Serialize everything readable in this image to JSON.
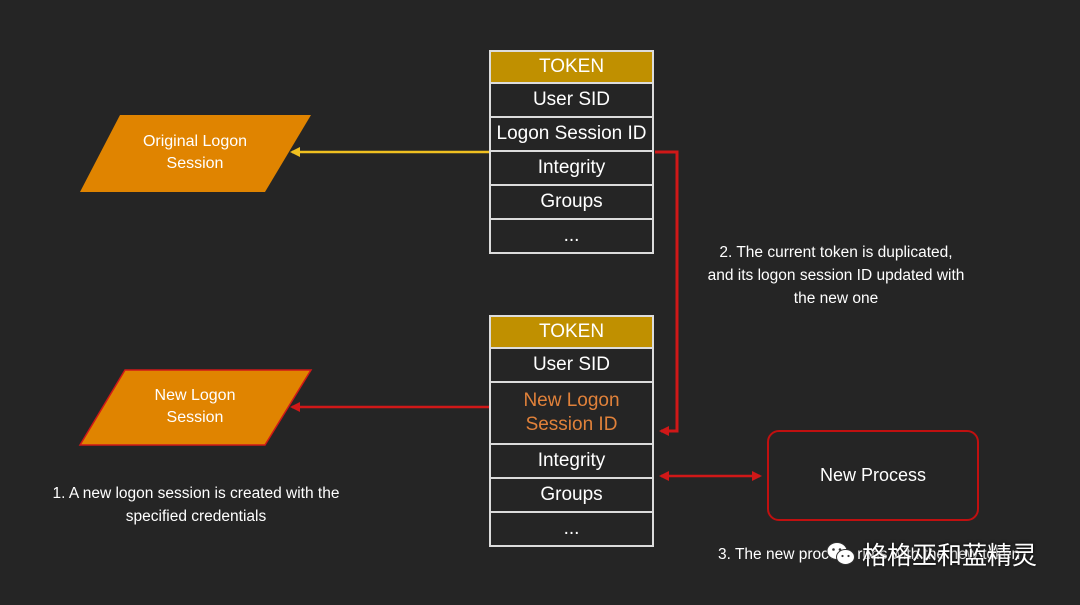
{
  "token_top": {
    "header": "TOKEN",
    "rows": [
      "User SID",
      "Logon Session ID",
      "Integrity",
      "Groups",
      "..."
    ]
  },
  "token_bottom": {
    "header": "TOKEN",
    "rows": [
      "User SID",
      "New Logon Session ID",
      "Integrity",
      "Groups",
      "..."
    ]
  },
  "original_session": {
    "label": "Original Logon Session"
  },
  "new_session": {
    "label": "New Logon Session"
  },
  "process": {
    "label": "New Process"
  },
  "notes": {
    "step1": "1. A new logon session is created with the specified credentials",
    "step2": "2. The current token is duplicated, and its logon session ID updated with the new one",
    "step3": "3. The new process runs with the new token"
  },
  "watermark": {
    "text": "格格巫和蓝精灵"
  },
  "colors": {
    "background": "#252525",
    "token_header": "#c09000",
    "session_fill": "#e08400",
    "yellow_arrow": "#f0c020",
    "red_arrow": "#d01818",
    "highlight_text": "#e0813a"
  }
}
